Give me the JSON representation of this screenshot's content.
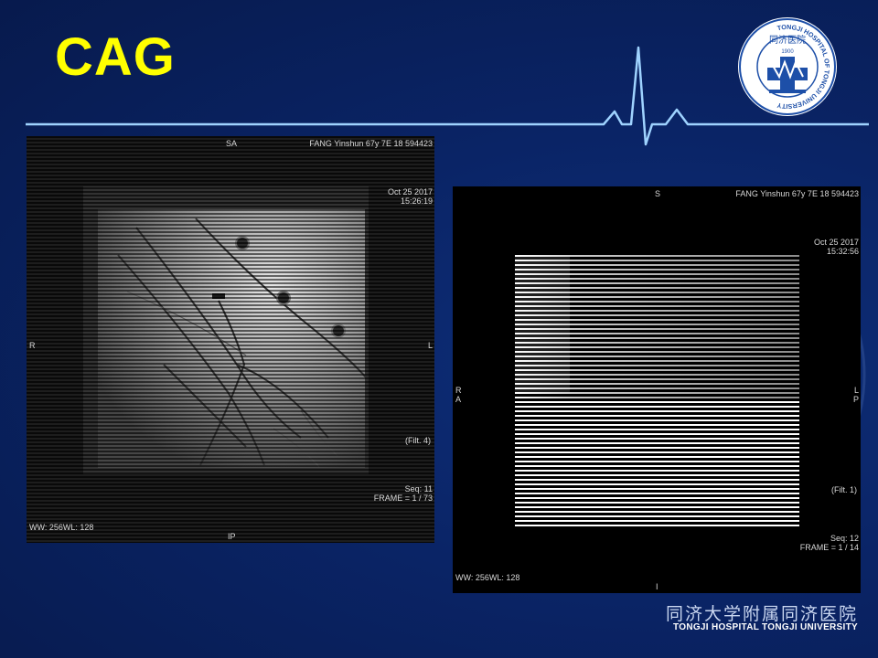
{
  "slide": {
    "title": "CAG",
    "colors": {
      "background": "#0a2466",
      "title": "#ffff00",
      "ecg": "#9fd3ff"
    }
  },
  "logo": {
    "name": "tongji-hospital-logo",
    "year": "1900",
    "text_cn": "同济医院",
    "ring_text": "TONGJI HOSPITAL OF TONGJI UNIVERSITY"
  },
  "left_image": {
    "top_center": "SA",
    "patient": "FANG Yinshun 67y 7E 18 594423",
    "date": "Oct 25 2017",
    "time": "15:26:19",
    "left_marker": "R",
    "right_marker": "L",
    "filter": "(Filt. 4)",
    "seq": "Seq: 11",
    "frame": "FRAME = 1 / 73",
    "window": "WW: 256WL: 128",
    "bottom_center": "IP"
  },
  "right_image": {
    "top_center": "S",
    "patient": "FANG Yinshun 67y 7E 18 594423",
    "date": "Oct 25 2017",
    "time": "15:32:56",
    "left_marker_1": "R",
    "left_marker_2": "A",
    "right_marker_1": "L",
    "right_marker_2": "P",
    "filter": "(Filt. 1)",
    "seq": "Seq: 12",
    "frame": "FRAME = 1 / 14",
    "window": "WW: 256WL: 128",
    "bottom_center": "I"
  },
  "footer": {
    "cn": "同济大学附属同济医院",
    "en": "TONGJI HOSPITAL TONGJI UNIVERSITY"
  }
}
